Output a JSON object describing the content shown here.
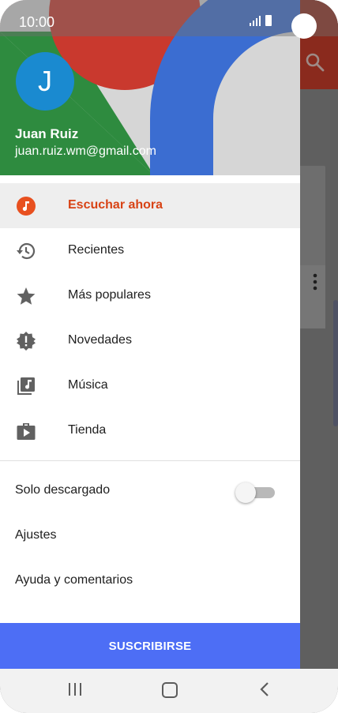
{
  "status_bar": {
    "time": "10:00"
  },
  "header": {
    "avatar_letter": "J",
    "user_name": "Juan Ruiz",
    "user_email": "juan.ruiz.wm@gmail.com"
  },
  "menu": {
    "items": [
      {
        "label": "Escuchar ahora",
        "icon": "music-note-icon",
        "active": true
      },
      {
        "label": "Recientes",
        "icon": "history-icon"
      },
      {
        "label": "Más populares",
        "icon": "star-icon"
      },
      {
        "label": "Novedades",
        "icon": "new-release-icon"
      },
      {
        "label": "Música",
        "icon": "music-library-icon"
      },
      {
        "label": "Tienda",
        "icon": "play-store-icon"
      }
    ]
  },
  "settings": {
    "downloaded_only": {
      "label": "Solo descargado",
      "enabled": false
    },
    "settings_label": "Ajustes",
    "help_label": "Ayuda y comentarios"
  },
  "subscribe_label": "SUSCRIBIRSE",
  "colors": {
    "accent": "#d84315",
    "subscribe": "#4d6ef5",
    "avatar": "#1a8ad0"
  }
}
